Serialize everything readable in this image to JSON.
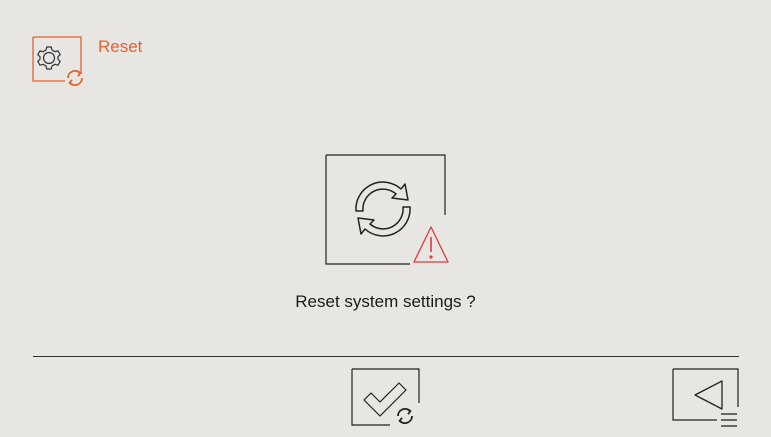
{
  "header": {
    "title": "Reset",
    "icon": "settings-reset-icon",
    "accent_color": "#e8602e"
  },
  "dialog": {
    "icon": "reset-warning-icon",
    "message": "Reset system settings ?",
    "warning_color": "#e03a3a"
  },
  "footer": {
    "confirm_icon": "confirm-reset-icon",
    "back_icon": "back-menu-icon"
  }
}
